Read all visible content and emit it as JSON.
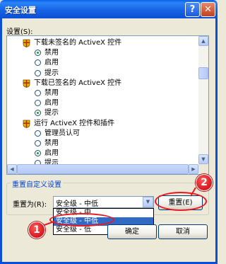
{
  "window": {
    "title": "安全设置",
    "help_glyph": "?",
    "close_glyph": "✕"
  },
  "settings": {
    "label": "设置(S):",
    "groups": [
      {
        "label": "下载未签名的 ActiveX 控件",
        "icon": "settings-shield-icon",
        "options": [
          {
            "label": "禁用",
            "selected": true
          },
          {
            "label": "启用",
            "selected": false
          },
          {
            "label": "提示",
            "selected": false
          }
        ]
      },
      {
        "label": "下载已签名的 ActiveX 控件",
        "icon": "settings-shield-icon",
        "options": [
          {
            "label": "禁用",
            "selected": false
          },
          {
            "label": "启用",
            "selected": false
          },
          {
            "label": "提示",
            "selected": true
          }
        ]
      },
      {
        "label": "运行 ActiveX 控件和插件",
        "icon": "settings-shield-icon",
        "options": [
          {
            "label": "管理员认可",
            "selected": false
          },
          {
            "label": "禁用",
            "selected": false
          },
          {
            "label": "启用",
            "selected": true
          },
          {
            "label": "提示",
            "selected": false
          }
        ]
      }
    ]
  },
  "reset_group": {
    "title": "重置自定义设置",
    "reset_to_label": "重置为(R):",
    "combo_value": "安全级 - 中低",
    "dropdown_options": [
      {
        "label": "安全级 - 中",
        "selected": false
      },
      {
        "label": "安全级 - 中低",
        "selected": true
      },
      {
        "label": "安全级 - 低",
        "selected": false
      }
    ],
    "reset_button": "重置(E)"
  },
  "buttons": {
    "ok": "确定",
    "cancel": "取消"
  },
  "annotations": {
    "callout_1": "1",
    "callout_2": "2",
    "color": "#e8191f"
  },
  "colors": {
    "titlebar": "#0b4fd4",
    "selection": "#316ac5",
    "radio_dot": "#21a121"
  }
}
